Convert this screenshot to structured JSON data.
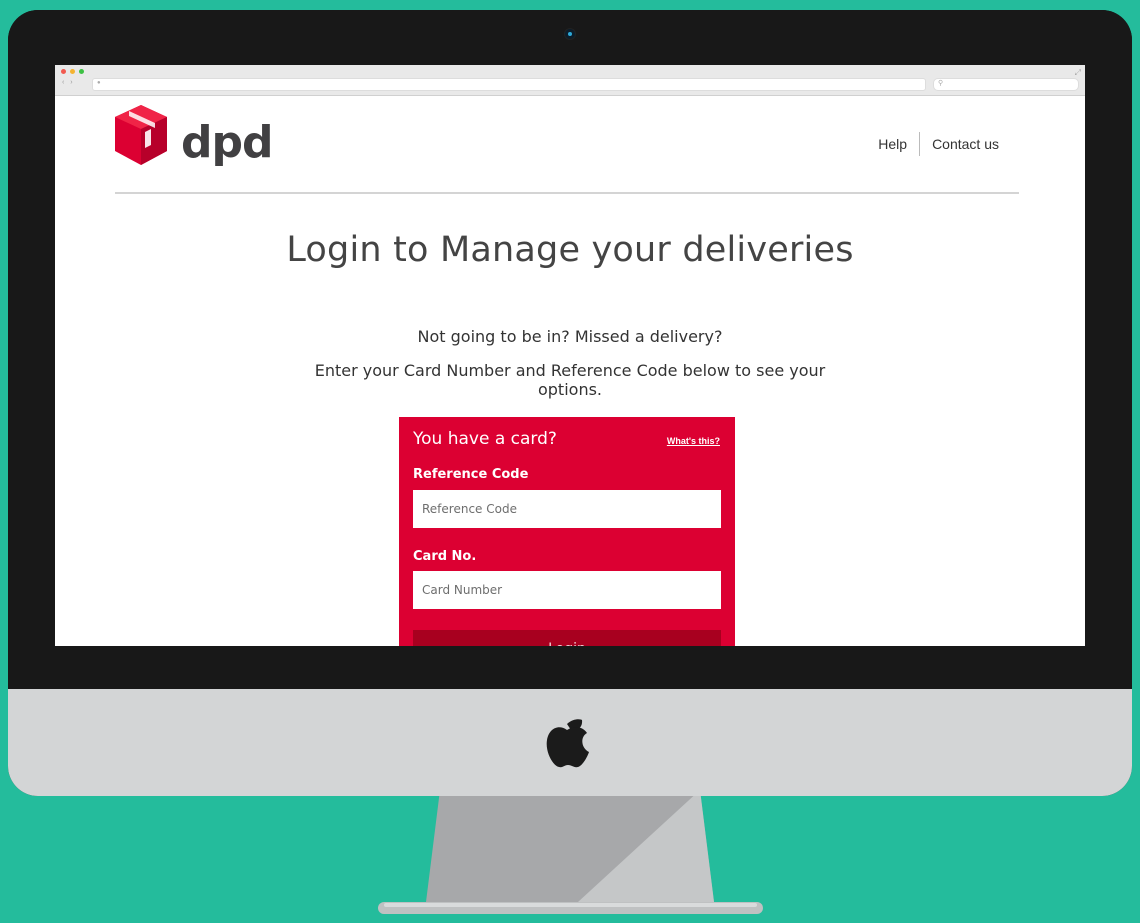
{
  "browser": {
    "nav_arrows": "‹ ›",
    "lock_icon": "●",
    "search_icon": "⚲",
    "expand_icon": "⤢"
  },
  "header": {
    "logo_text": "dpd",
    "links": {
      "help": "Help",
      "contact": "Contact us"
    }
  },
  "main": {
    "title": "Login to Manage your deliveries",
    "subtitle": "Not going to be in? Missed a delivery?",
    "instructions": "Enter your Card Number and Reference Code below to see your options."
  },
  "card_form": {
    "title": "You have a card?",
    "whats_this": "What's this?",
    "reference_label": "Reference Code",
    "reference_placeholder": "Reference Code",
    "card_label": "Card No.",
    "card_placeholder": "Card Number",
    "login_label": "Login"
  },
  "colors": {
    "background": "#24bc9c",
    "brand_red": "#dc0032",
    "login_button": "#a8001f",
    "bezel": "#181818",
    "chin": "#d3d5d6"
  }
}
